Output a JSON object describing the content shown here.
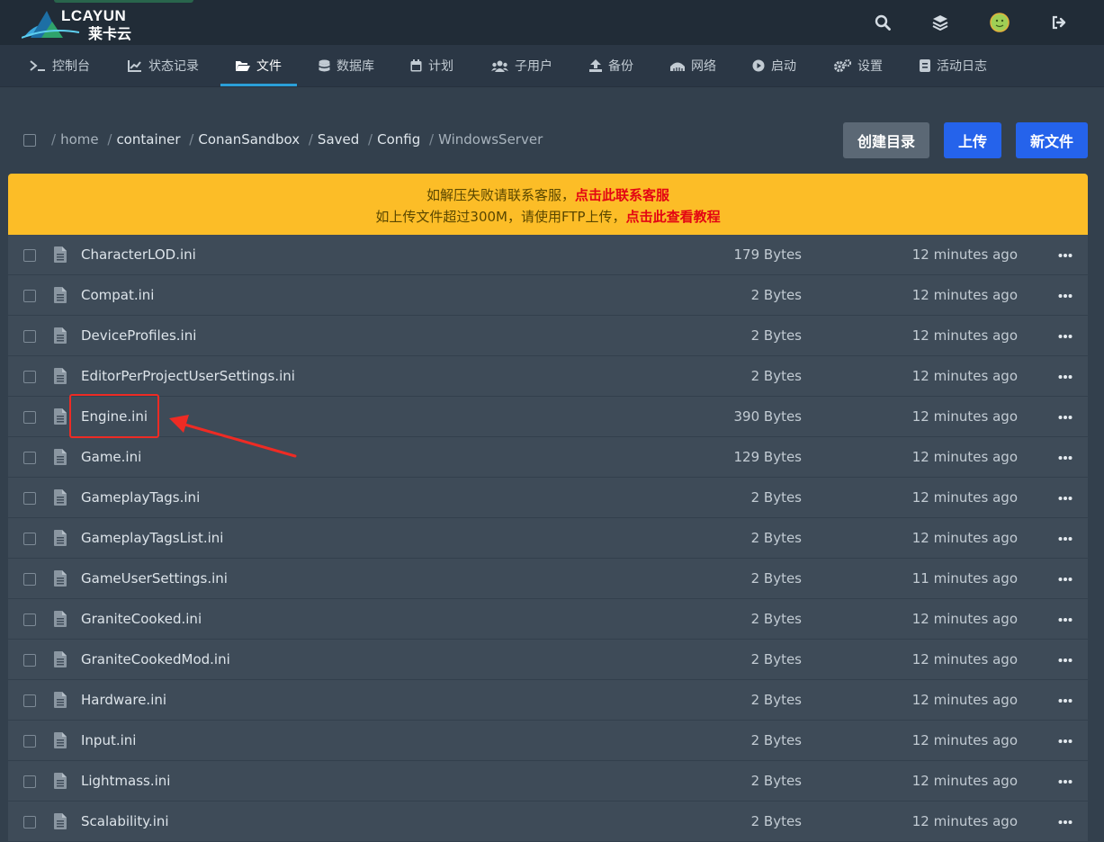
{
  "brand": {
    "name_en": "LCAYUN",
    "name_zh": "莱卡云"
  },
  "header_icons": [
    "search-icon",
    "layers-icon",
    "avatar",
    "logout-icon"
  ],
  "nav": {
    "items": [
      {
        "label": "控制台",
        "icon": "terminal-icon"
      },
      {
        "label": "状态记录",
        "icon": "chart-icon"
      },
      {
        "label": "文件",
        "icon": "folder-open-icon"
      },
      {
        "label": "数据库",
        "icon": "database-icon"
      },
      {
        "label": "计划",
        "icon": "calendar-icon"
      },
      {
        "label": "子用户",
        "icon": "users-icon"
      },
      {
        "label": "备份",
        "icon": "upload-icon"
      },
      {
        "label": "网络",
        "icon": "network-icon"
      },
      {
        "label": "启动",
        "icon": "play-icon"
      },
      {
        "label": "设置",
        "icon": "gears-icon"
      },
      {
        "label": "活动日志",
        "icon": "log-icon"
      }
    ],
    "active": "文件"
  },
  "breadcrumb": {
    "sep": "/",
    "parts": [
      "home",
      "container",
      "ConanSandbox",
      "Saved",
      "Config"
    ],
    "current": "WindowsServer"
  },
  "toolbar": {
    "create_dir": "创建目录",
    "upload": "上传",
    "new_file": "新文件"
  },
  "colors": {
    "accent": "#2b9fd8",
    "primary_button": "#2563eb",
    "secondary_button": "#5b6875",
    "notice_bg": "#fcbd27",
    "notice_link": "#e30613",
    "highlight": "#ee2b24"
  },
  "notice": {
    "line1_text": "如解压失败请联系客服，",
    "line1_link": "点击此联系客服",
    "line2_text": "如上传文件超过300M，请使用FTP上传，",
    "line2_link": "点击此查看教程"
  },
  "files": [
    {
      "name": "CharacterLOD.ini",
      "size": "179 Bytes",
      "time": "12 minutes ago"
    },
    {
      "name": "Compat.ini",
      "size": "2 Bytes",
      "time": "12 minutes ago"
    },
    {
      "name": "DeviceProfiles.ini",
      "size": "2 Bytes",
      "time": "12 minutes ago"
    },
    {
      "name": "EditorPerProjectUserSettings.ini",
      "size": "2 Bytes",
      "time": "12 minutes ago"
    },
    {
      "name": "Engine.ini",
      "size": "390 Bytes",
      "time": "12 minutes ago"
    },
    {
      "name": "Game.ini",
      "size": "129 Bytes",
      "time": "12 minutes ago"
    },
    {
      "name": "GameplayTags.ini",
      "size": "2 Bytes",
      "time": "12 minutes ago"
    },
    {
      "name": "GameplayTagsList.ini",
      "size": "2 Bytes",
      "time": "12 minutes ago"
    },
    {
      "name": "GameUserSettings.ini",
      "size": "2 Bytes",
      "time": "11 minutes ago"
    },
    {
      "name": "GraniteCooked.ini",
      "size": "2 Bytes",
      "time": "12 minutes ago"
    },
    {
      "name": "GraniteCookedMod.ini",
      "size": "2 Bytes",
      "time": "12 minutes ago"
    },
    {
      "name": "Hardware.ini",
      "size": "2 Bytes",
      "time": "12 minutes ago"
    },
    {
      "name": "Input.ini",
      "size": "2 Bytes",
      "time": "12 minutes ago"
    },
    {
      "name": "Lightmass.ini",
      "size": "2 Bytes",
      "time": "12 minutes ago"
    },
    {
      "name": "Scalability.ini",
      "size": "2 Bytes",
      "time": "12 minutes ago"
    }
  ],
  "annotation": {
    "highlighted_file": "Engine.ini"
  }
}
